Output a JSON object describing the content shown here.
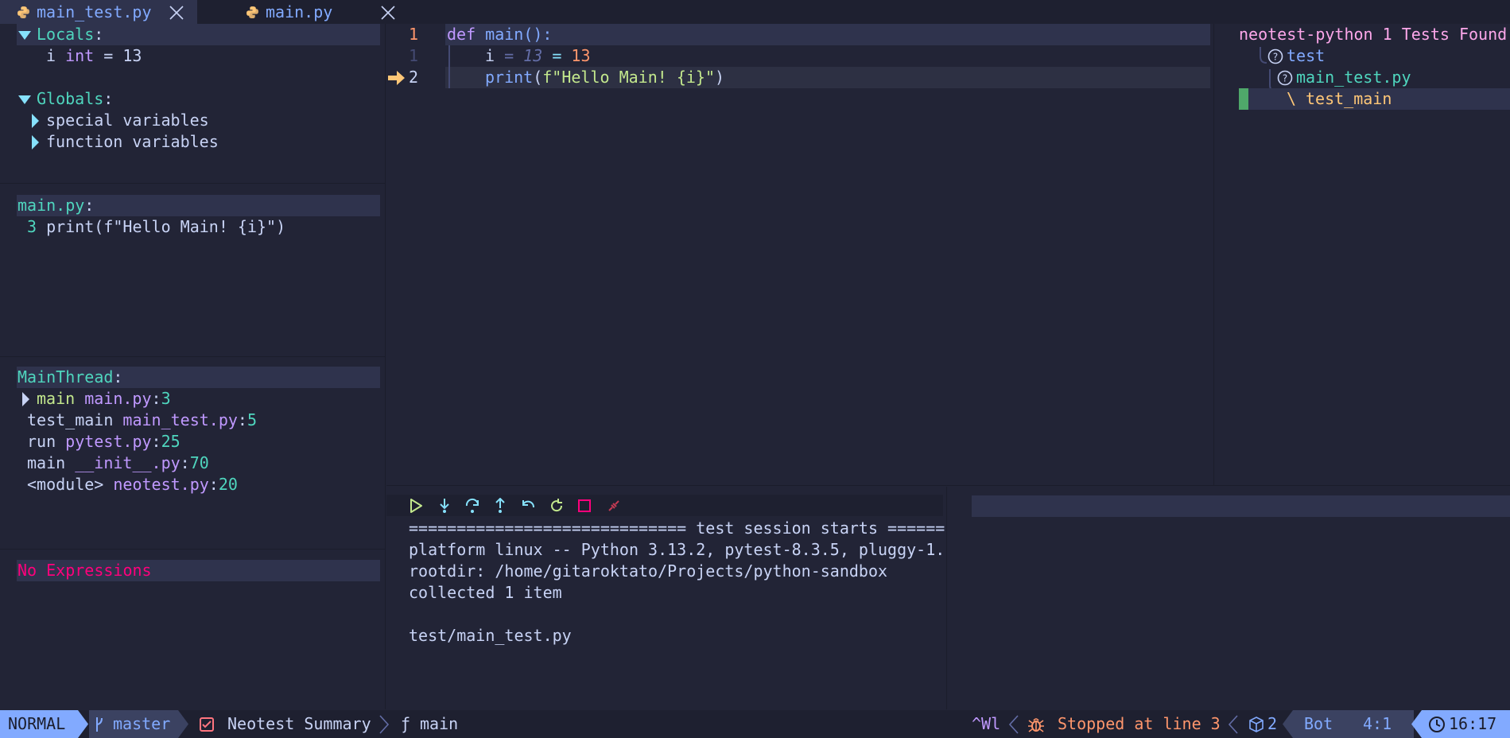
{
  "tabs": [
    {
      "label": "main_test.py",
      "icon": "python-icon"
    },
    {
      "label": "main.py",
      "icon": "python-icon"
    }
  ],
  "scopes": {
    "locals_header": "Locals",
    "local_var": {
      "name": "i",
      "type": "int",
      "eq": "=",
      "value": "13"
    },
    "globals_header": "Globals",
    "globals_items": [
      "special variables",
      "function variables"
    ]
  },
  "breakpoints": {
    "file": "main.py",
    "line_no": "3",
    "line_text": "print(f\"Hello Main! {i}\")"
  },
  "stacks": {
    "thread": "MainThread",
    "frames": [
      {
        "fn": "main",
        "file": "main.py",
        "line": "3"
      },
      {
        "fn": "test_main",
        "file": "main_test.py",
        "line": "5"
      },
      {
        "fn": "run",
        "file": "pytest.py",
        "line": "25"
      },
      {
        "fn": "main",
        "file": "__init__.py",
        "line": "70"
      },
      {
        "fn": "<module>",
        "file": "neotest.py",
        "line": "20"
      }
    ]
  },
  "watches": {
    "empty": "No Expressions"
  },
  "editor": {
    "line1": {
      "num": "1",
      "kw": "def",
      "fn": "main",
      "rest": "():"
    },
    "line2": {
      "num": "1",
      "var": "i",
      "hint": "= 13",
      "eq": "=",
      "value": "13"
    },
    "line3": {
      "num": "2",
      "fn": "print",
      "open": "(",
      "str": "f\"Hello Main! {i}\"",
      "close": ")"
    }
  },
  "neotest": {
    "title": "neotest-python 1 Tests Found",
    "items": [
      "test",
      "main_test.py",
      "test_main"
    ],
    "branch": "\\"
  },
  "repl": {
    "lines": [
      "============================= test session starts ======",
      "platform linux -- Python 3.13.2, pytest-8.3.5, pluggy-1.",
      "rootdir: /home/gitaroktato/Projects/python-sandbox",
      "collected 1 item",
      "",
      "test/main_test.py"
    ]
  },
  "statusline": {
    "mode": "NORMAL",
    "branch": "master",
    "buffer": "Neotest Summary",
    "func_icon": "ƒ",
    "func": "main",
    "keys": "^Wl",
    "debug_status": "Stopped at line 3",
    "count": "2",
    "position": "Bot",
    "cursor": "4:1",
    "time": "16:17"
  },
  "colors": {
    "bg": "#222436",
    "accent": "#82aaff",
    "teal": "#4fd6be",
    "orange": "#ff966c",
    "error": "#ff007c"
  }
}
